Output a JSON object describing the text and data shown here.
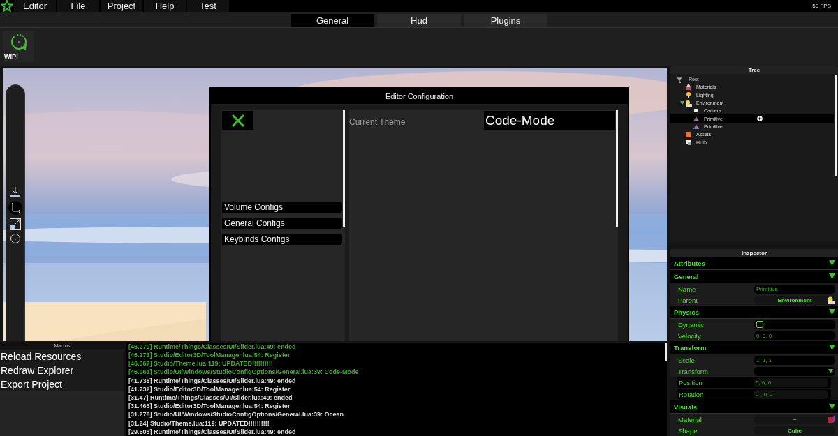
{
  "menu": [
    "Editor",
    "File",
    "Project",
    "Help",
    "Test"
  ],
  "fps": "59 FPS",
  "tabs": [
    {
      "label": "General",
      "selected": true
    },
    {
      "label": "Hud",
      "selected": false
    },
    {
      "label": "Plugins",
      "selected": false
    }
  ],
  "toolbar": [
    {
      "label": "WIP!"
    }
  ],
  "dialog": {
    "title": "Editor Configuration",
    "categories": [
      "Volume Configs",
      "General Configs",
      "Keybinds Configs"
    ],
    "setting_label": "Current Theme",
    "setting_value": "Code-Mode"
  },
  "tree": {
    "title": "Tree",
    "items": [
      {
        "label": "Root",
        "kind": "root",
        "selected": false,
        "children": [
          {
            "label": "Materials",
            "kind": "materials",
            "selected": false
          },
          {
            "label": "Lighting",
            "kind": "light",
            "selected": false
          },
          {
            "label": "Environment",
            "kind": "environment",
            "selected": false,
            "expanded": true,
            "children": [
              {
                "label": "Camera",
                "kind": "camera",
                "selected": false
              },
              {
                "label": "Primitive",
                "kind": "primitive",
                "selected": true
              },
              {
                "label": "Primitive",
                "kind": "primitive",
                "selected": false
              }
            ]
          },
          {
            "label": "Assets",
            "kind": "assets",
            "selected": false
          },
          {
            "label": "HUD",
            "kind": "hud",
            "selected": false
          }
        ]
      }
    ]
  },
  "inspector": {
    "title": "Inspector",
    "sections": [
      {
        "title": "Attributes",
        "expanded": true
      },
      {
        "title": "General",
        "expanded": true,
        "rows": [
          {
            "kind": "text",
            "label": "Name",
            "value": "Primitive"
          },
          {
            "kind": "parent",
            "label": "Parent",
            "value": "Environment"
          }
        ]
      },
      {
        "title": "Physics",
        "expanded": true,
        "rows": [
          {
            "kind": "checkbox",
            "label": "Dynamic",
            "checked": false
          },
          {
            "kind": "text",
            "label": "Velocity",
            "value": "0, 0, 0"
          }
        ]
      },
      {
        "title": "Transform",
        "expanded": true,
        "rows": [
          {
            "kind": "text",
            "label": "Scale",
            "value": "1, 1, 1"
          },
          {
            "kind": "dropdown",
            "label": "Transform",
            "children": [
              {
                "kind": "text",
                "label": "Position",
                "value": "0, 0, 0"
              },
              {
                "kind": "text",
                "label": "Rotation",
                "value": "-0, 0, -0"
              }
            ]
          }
        ]
      },
      {
        "title": "Visuals",
        "expanded": true,
        "rows": [
          {
            "kind": "material",
            "label": "Material",
            "value": "~"
          },
          {
            "kind": "picker",
            "label": "Shape",
            "value": "Cube"
          }
        ]
      }
    ]
  },
  "macros": {
    "title": "Macros",
    "items": [
      "Reload Resources",
      "Redraw Explorer",
      "Export Project"
    ]
  },
  "console": [
    {
      "text": "[46.279] Runtime/Things/Classes/UI/Slider.lua:49: ended",
      "color": "#3fae2a"
    },
    {
      "text": "[46.271] Studio/Editor3D/ToolManager.lua:54: Register",
      "color": "#3fae2a"
    },
    {
      "text": "[46.067] Studio/Theme.lua:119: UPDATED!!!!!!!!!!",
      "color": "#3fae2a"
    },
    {
      "text": "[46.061] Studio/UI/Windows/StudioConfigOptions/General.lua:39: Code-Mode",
      "color": "#3fae2a"
    },
    {
      "text": "[41.738] Runtime/Things/Classes/UI/Slider.lua:49: ended",
      "color": "#e0e0e0"
    },
    {
      "text": "[41.732] Studio/Editor3D/ToolManager.lua:54: Register",
      "color": "#e0e0e0"
    },
    {
      "text": "[31.47] Runtime/Things/Classes/UI/Slider.lua:49: ended",
      "color": "#e0e0e0"
    },
    {
      "text": "[31.463] Studio/Editor3D/ToolManager.lua:54: Register",
      "color": "#e0e0e0"
    },
    {
      "text": "[31.276] Studio/UI/Windows/StudioConfigOptions/General.lua:39: Ocean",
      "color": "#e0e0e0"
    },
    {
      "text": "[31.24] Studio/Theme.lua:119: UPDATED!!!!!!!!!!",
      "color": "#e0e0e0"
    },
    {
      "text": "[29.503] Runtime/Things/Classes/UI/Slider.lua:49: ended",
      "color": "#e0e0e0"
    }
  ]
}
